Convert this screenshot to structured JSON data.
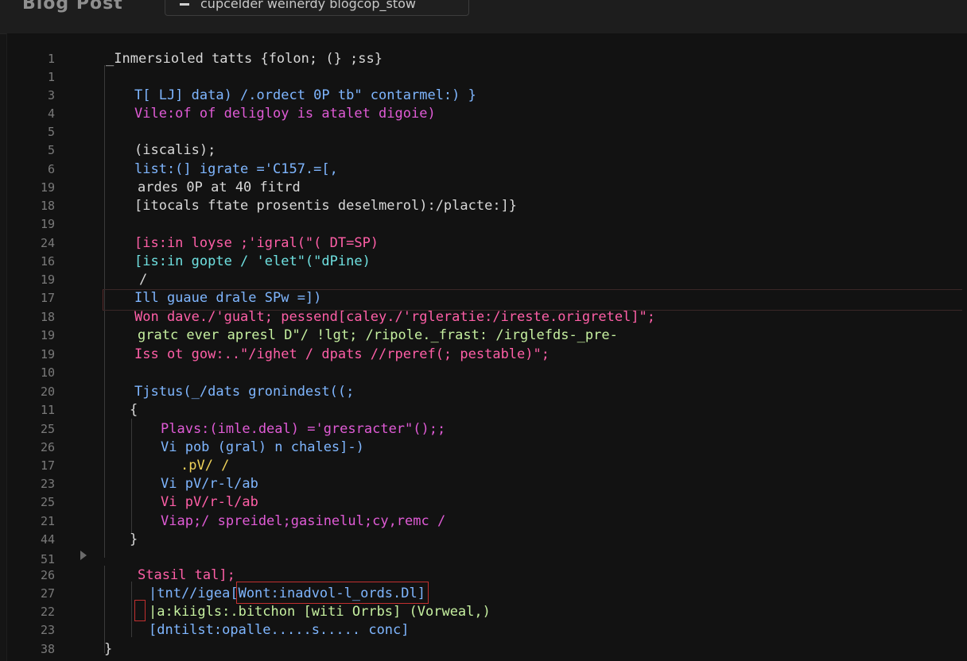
{
  "window": {
    "app_title": "Blog Post",
    "file_tab": "cupcelder weinerdy blogcop_stow"
  },
  "lines": [
    {
      "num": "1",
      "text": "_Inmersioled tatts {folon; (} ;ss}"
    },
    {
      "num": "1",
      "text": ""
    },
    {
      "num": "3",
      "text": "T[ LJ] data) /.ordect 0P tb\" contarmel:) }"
    },
    {
      "num": "4",
      "text": "Vile:of of deligloy is atalet digoie)"
    },
    {
      "num": "5",
      "text": ""
    },
    {
      "num": "5",
      "text": "(iscalis);"
    },
    {
      "num": "6",
      "text": "list:(] igrate ='C157.=[,"
    },
    {
      "num": "19",
      "text": "ardes 0P at 40 fitrd"
    },
    {
      "num": "18",
      "text": "[itocals ftate prosentis deselmerol):/placte:]}"
    },
    {
      "num": "19",
      "text": ""
    },
    {
      "num": "24",
      "text": "[is:in loyse ;'igral(\"( DT=SP)"
    },
    {
      "num": "16",
      "text": "[is:in gopte / 'elet\"(\"dPine)"
    },
    {
      "num": "19",
      "text": "/"
    },
    {
      "num": "17",
      "text": "Ill guaue drale SPw =])"
    },
    {
      "num": "18",
      "text": "Won dave./'gualt; pessend[caley./'rgleratie:/ireste.origretel]\";"
    },
    {
      "num": "19",
      "text": "gratc ever apresl D\"/ !lgt; /ripole._frast: /irglefds-_pre-"
    },
    {
      "num": "19",
      "text": "Iss ot gow:..\"/ighet / dpats //rperef(; pestable)\";"
    },
    {
      "num": "10",
      "text": ""
    },
    {
      "num": "20",
      "text": "Tjstus(_/dats gronindest((;"
    },
    {
      "num": "11",
      "text": "{"
    },
    {
      "num": "25",
      "text": "Plavs:(imle.deal) ='gresracter\"();;"
    },
    {
      "num": "26",
      "text": "Vi pob (gral) n chales]-)"
    },
    {
      "num": "17",
      "text": ".pV/ /"
    },
    {
      "num": "23",
      "text": "Vi pV/r-l/ab"
    },
    {
      "num": "25",
      "text": "Vi pV/r-l/ab"
    },
    {
      "num": "21",
      "text": "Viap;/ spreidel;gasinelul;cy,remc /"
    },
    {
      "num": "44",
      "text": "}"
    },
    {
      "num": "51",
      "text": ""
    },
    {
      "num": "26",
      "text": "Stasil tal];"
    },
    {
      "num": "27",
      "text": "|tnt//igea[Wont:inadvol-l_ords.Dl]"
    },
    {
      "num": "22",
      "text": "|a:kiigls:.bitchon [witi Orrbs] (Vorweal,)"
    },
    {
      "num": "23",
      "text": "[dntilst:opalle.....s..... conc]"
    },
    {
      "num": "38",
      "text": "}"
    }
  ],
  "colors": {
    "background": "#121212",
    "line_number": "#7a7a7a",
    "highlight_border": "#c23030"
  }
}
